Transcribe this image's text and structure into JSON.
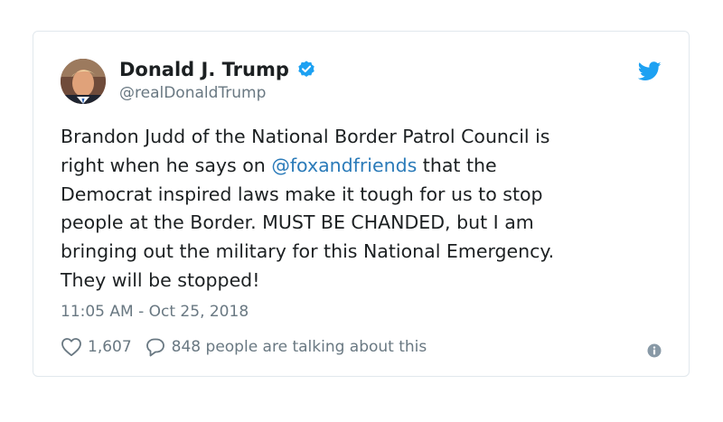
{
  "author": {
    "display_name": "Donald J. Trump",
    "handle": "@realDonaldTrump",
    "verified": true
  },
  "tweet": {
    "lines": [
      {
        "before": "Brandon Judd of the National Border Patrol Council is",
        "mention": "",
        "after": ""
      },
      {
        "before": "right when he says on ",
        "mention": "@foxandfriends",
        "after": " that the"
      },
      {
        "before": "Democrat inspired laws make it tough for us to stop",
        "mention": "",
        "after": ""
      },
      {
        "before": "people at the Border. MUST BE CHANDED, but I am",
        "mention": "",
        "after": ""
      },
      {
        "before": "bringing out the military for this National Emergency.",
        "mention": "",
        "after": ""
      },
      {
        "before": "They will be stopped!",
        "mention": "",
        "after": ""
      }
    ],
    "timestamp": "11:05 AM - Oct 25, 2018"
  },
  "engagement": {
    "likes": "1,607",
    "talking": "848 people are talking about this"
  },
  "icons": {
    "brand": "twitter-bird-icon",
    "verified": "verified-badge-icon",
    "like": "heart-icon",
    "reply": "speech-bubble-icon",
    "info": "info-icon"
  },
  "colors": {
    "brand_blue": "#1da1f2",
    "link": "#2b7bb9",
    "muted": "#697882",
    "text": "#1c2022",
    "border": "#e1e8ed"
  }
}
